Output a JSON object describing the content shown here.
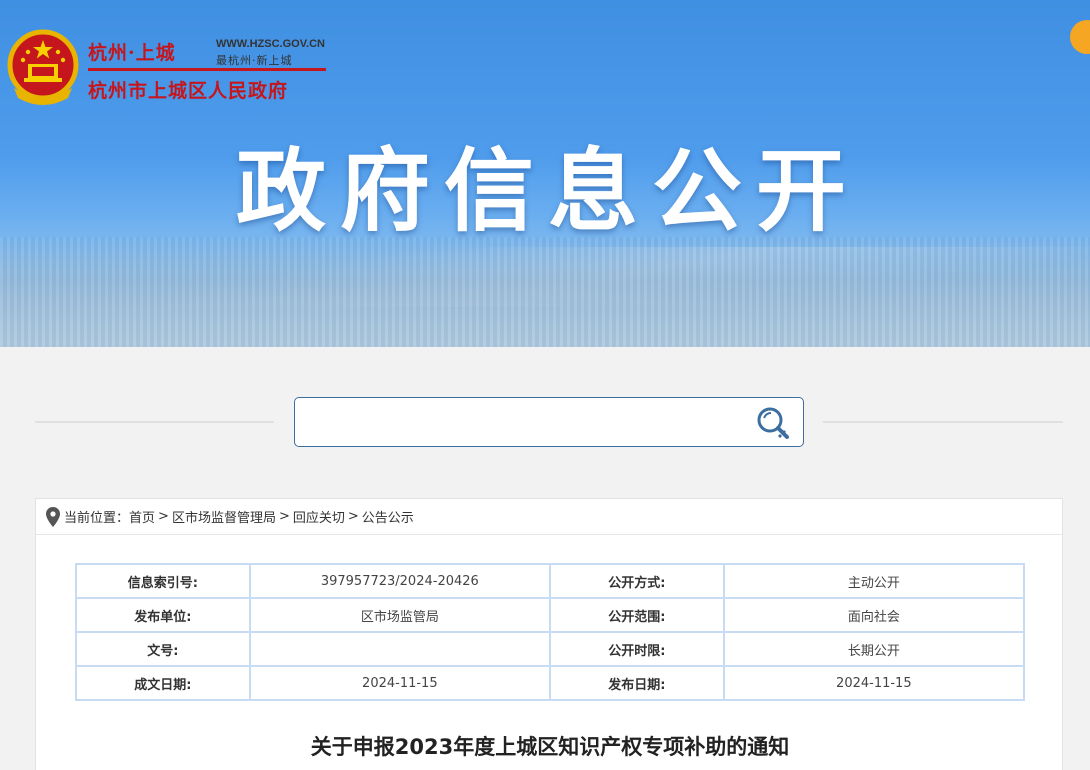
{
  "header": {
    "site_name_top": "杭州·上城",
    "site_url": "WWW.HZSC.GOV.CN",
    "site_slogan": "最杭州·新上城",
    "site_name_bottom": "杭州市上城区人民政府",
    "banner_title": "政府信息公开"
  },
  "search": {
    "placeholder": "",
    "value": ""
  },
  "breadcrumb": {
    "prefix": "当前位置：",
    "items": [
      "首页",
      "区市场监督管理局",
      "回应关切",
      "公告公示"
    ],
    "separator": ">"
  },
  "meta_table": {
    "rows": [
      {
        "label1": "信息索引号:",
        "value1": "397957723/2024-20426",
        "label2": "公开方式:",
        "value2": "主动公开"
      },
      {
        "label1": "发布单位:",
        "value1": "区市场监管局",
        "label2": "公开范围:",
        "value2": "面向社会"
      },
      {
        "label1": "文号:",
        "value1": "",
        "label2": "公开时限:",
        "value2": "长期公开"
      },
      {
        "label1": "成文日期:",
        "value1": "2024-11-15",
        "label2": "发布日期:",
        "value2": "2024-11-15"
      }
    ]
  },
  "document": {
    "title": "关于申报2023年度上城区知识产权专项补助的通知"
  },
  "colors": {
    "brand_red": "#c4161c",
    "banner_blue": "#4f9cec",
    "table_border": "#c7dcf2",
    "search_border": "#3d6ea0"
  }
}
